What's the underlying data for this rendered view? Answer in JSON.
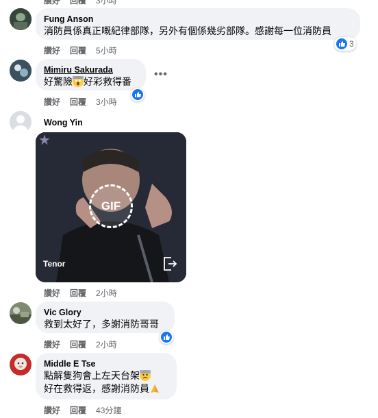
{
  "top_cut": {
    "time": "3小時",
    "reply": "回覆",
    "like": "讚好"
  },
  "comments": [
    {
      "author": "Fung Anson",
      "text": "消防員係真正嘅紀律部隊，另外有個係幾劣部隊。感謝每一位消防員",
      "like": "讚好",
      "reply": "回覆",
      "time": "5小時",
      "reactions": "3"
    },
    {
      "author": "Mimiru Sakurada",
      "text_a": "好驚險",
      "text_b": "好彩救得番",
      "like": "讚好",
      "reply": "回覆",
      "time": "3小時",
      "emoji": "scream-emoji"
    },
    {
      "author": "Wong Yin",
      "gif_badge": "GIF",
      "gif_source": "Tenor",
      "like": "讚好",
      "reply": "回覆",
      "time": "2小時"
    },
    {
      "author": "Vic Glory",
      "text": "救到太好了，多謝消防哥哥",
      "like": "讚好",
      "reply": "回覆",
      "time": "2小時"
    },
    {
      "author": "Middle E Tse",
      "text_line1": "點解隻狗會上左天台架",
      "text_line2": "好在救得返，感謝消防員",
      "like": "讚好",
      "reply": "回覆",
      "time": "43分鐘"
    }
  ],
  "colors": {
    "bubble": "#f0f2f5",
    "meta": "#65676b",
    "like_blue": "#1877f2"
  }
}
